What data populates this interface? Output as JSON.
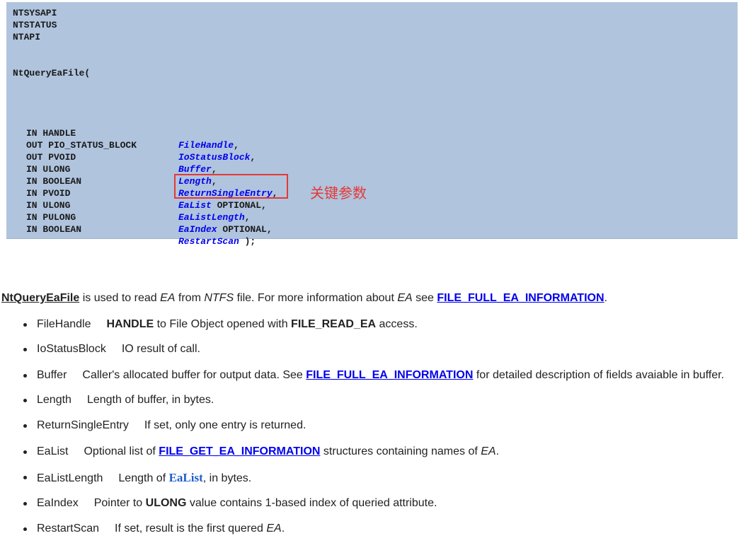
{
  "code": {
    "header_lines": [
      "NTSYSAPI",
      "NTSTATUS",
      "NTAPI"
    ],
    "function_open": "NtQueryEaFile(",
    "params": [
      {
        "type": "IN HANDLE",
        "name": "FileHandle",
        "suffix": ","
      },
      {
        "type": "OUT PIO_STATUS_BLOCK",
        "name": "IoStatusBlock",
        "suffix": ","
      },
      {
        "type": "OUT PVOID",
        "name": "Buffer",
        "suffix": ","
      },
      {
        "type": "IN ULONG",
        "name": "Length",
        "suffix": ","
      },
      {
        "type": "IN BOOLEAN",
        "name": "ReturnSingleEntry",
        "suffix": ","
      },
      {
        "type": "IN PVOID",
        "name": "EaList",
        "suffix": " OPTIONAL,"
      },
      {
        "type": "IN ULONG",
        "name": "EaListLength",
        "suffix": ","
      },
      {
        "type": "IN PULONG",
        "name": "EaIndex",
        "suffix": " OPTIONAL,"
      },
      {
        "type": "IN BOOLEAN",
        "name": "RestartScan",
        "suffix": " );"
      }
    ],
    "annotation": "关键参数",
    "colors": {
      "background": "#b0c4de",
      "param_name": "#0000ee",
      "annotation": "#e53935"
    }
  },
  "description": {
    "func_link": "NtQueryEaFile",
    "t1": " is used to read ",
    "em1": "EA",
    "t2": " from ",
    "em2": "NTFS",
    "t3": " file. For more information about ",
    "em3": "EA",
    "t4": " see ",
    "link": "FILE_FULL_EA_INFORMATION",
    "t5": "."
  },
  "params_doc": {
    "filehandle": {
      "name": "FileHandle",
      "b1": "HANDLE",
      "t1": " to File Object opened with ",
      "b2": "FILE_READ_EA",
      "t2": " access."
    },
    "iostatusblock": {
      "name": "IoStatusBlock",
      "t1": "IO result of call."
    },
    "buffer": {
      "name": "Buffer",
      "t1": "Caller's allocated buffer for output data. See ",
      "link": "FILE_FULL_EA_INFORMATION",
      "t2": " for detailed description of fields avaiable in buffer."
    },
    "length": {
      "name": "Length",
      "t1": "Length of buffer, in bytes."
    },
    "returnsingleentry": {
      "name": "ReturnSingleEntry",
      "t1": "If set, only one entry is returned."
    },
    "ealist": {
      "name": "EaList",
      "t1": "Optional list of ",
      "link": "FILE_GET_EA_INFORMATION",
      "t2": " structures containing names of ",
      "em": "EA",
      "t3": "."
    },
    "ealistlength": {
      "name": "EaListLength",
      "t1": "Length of ",
      "link": "EaList",
      "t2": ", in bytes."
    },
    "eaindex": {
      "name": "EaIndex",
      "t1": "Pointer to ",
      "b1": "ULONG",
      "t2": " value contains 1-based index of queried attribute."
    },
    "restartscan": {
      "name": "RestartScan",
      "t1": "If set, result is the first quered ",
      "em": "EA",
      "t2": "."
    }
  }
}
